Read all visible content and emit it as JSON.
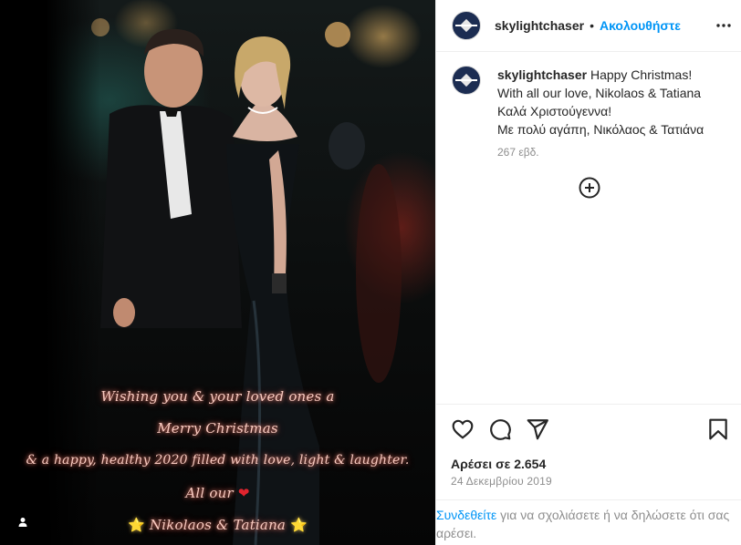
{
  "post": {
    "overlay_lines": [
      "Wishing you & your loved ones a",
      "Merry Christmas",
      "& a happy, healthy 2020 filled with love, light & laughter.",
      "All our",
      "Nikolaos & Tatiana"
    ],
    "heart_glyph": "❤",
    "star_glyph": "⭐"
  },
  "header": {
    "username": "skylightchaser",
    "separator": "•",
    "follow_label": "Ακολουθήστε",
    "more_icon": "more-horizontal-icon"
  },
  "caption": {
    "username": "skylightchaser",
    "lines": [
      "Happy Christmas!",
      "With all our love, Nikolaos & Tatiana",
      "Καλά Χριστούγεννα!",
      "Με πολύ αγάπη, Νικόλαος & Τατιάνα"
    ],
    "time_ago": "267 εβδ."
  },
  "actions": {
    "icons": [
      "heart-icon",
      "comment-icon",
      "share-icon",
      "bookmark-icon"
    ],
    "likes_text": "Αρέσει σε 2.654",
    "date": "24 Δεκεμβρίου 2019"
  },
  "login": {
    "link_text": "Συνδεθείτε",
    "rest_text": " για να σχολιάσετε ή να δηλώσετε ότι σας αρέσει."
  },
  "colors": {
    "accent": "#0095f6",
    "overlay_text": "#f7c9bf",
    "muted": "#8e8e8e"
  }
}
